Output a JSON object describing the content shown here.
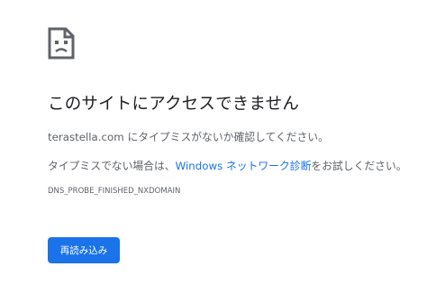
{
  "error_page": {
    "icon": "sad-page-icon",
    "heading": "このサイトにアクセスできません",
    "message": "terastella.com にタイプミスがないか確認してください。",
    "suggestion_prefix": "タイプミスでない場合は、",
    "suggestion_link": "Windows ネットワーク診断",
    "suggestion_suffix": "をお試しください。",
    "error_code": "DNS_PROBE_FINISHED_NXDOMAIN",
    "reload_label": "再読み込み"
  },
  "colors": {
    "accent": "#1a73e8",
    "text_primary": "#202124",
    "text_secondary": "#5f6368"
  }
}
